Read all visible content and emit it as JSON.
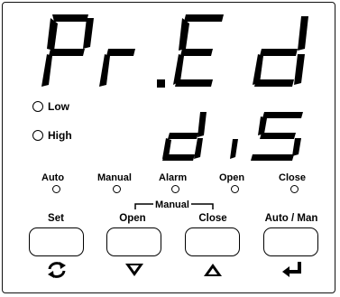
{
  "display": {
    "upper": "Pr.Ed",
    "lower": "diS"
  },
  "indicators": {
    "low": "Low",
    "high": "High"
  },
  "status_leds": [
    {
      "label": "Auto"
    },
    {
      "label": "Manual"
    },
    {
      "label": "Alarm"
    },
    {
      "label": "Open"
    },
    {
      "label": "Close"
    }
  ],
  "keys": {
    "set": "Set",
    "open": "Open",
    "manual_group": "Manual",
    "close": "Close",
    "auto_man": "Auto / Man"
  },
  "icons": {
    "set": "refresh-icon",
    "open": "down-arrow-icon",
    "close": "up-arrow-icon",
    "auto_man": "enter-icon"
  }
}
